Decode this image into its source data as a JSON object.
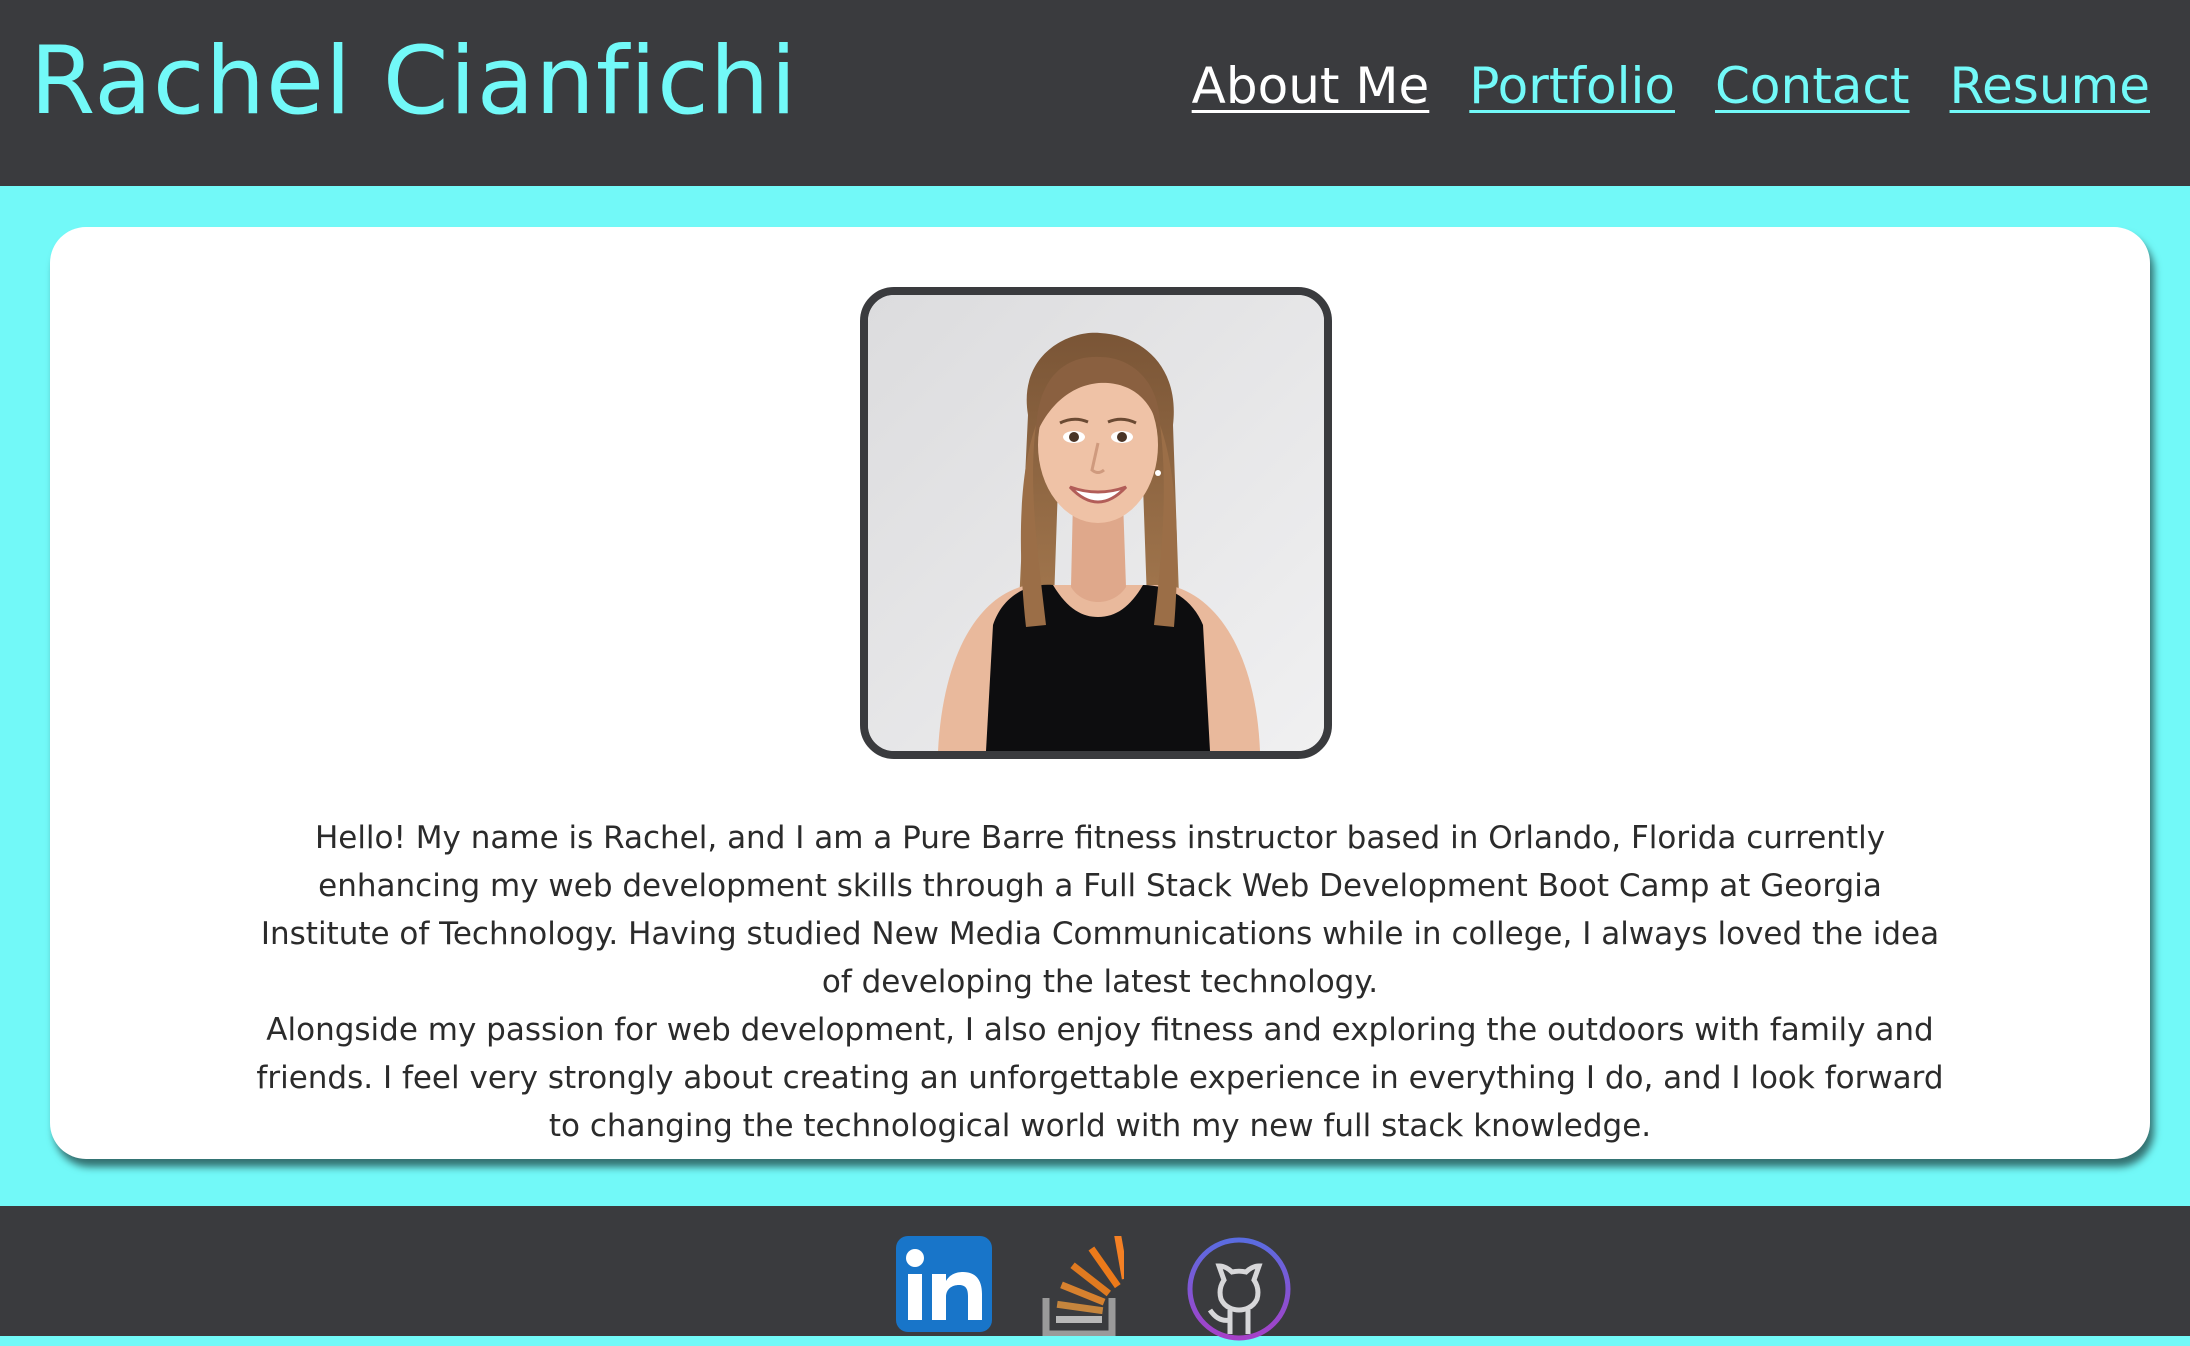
{
  "header": {
    "title": "Rachel Cianfichi",
    "nav": [
      {
        "label": "About Me",
        "active": true
      },
      {
        "label": "Portfolio",
        "active": false
      },
      {
        "label": "Contact",
        "active": false
      },
      {
        "label": "Resume",
        "active": false
      }
    ]
  },
  "about": {
    "photo_alt": "profile-photo",
    "paragraph_1": "Hello! My name is Rachel, and I am a Pure Barre fitness instructor based in Orlando, Florida currently enhancing my web development skills through a Full Stack Web Development Boot Camp at Georgia Institute of Technology. Having studied New Media Communications while in college, I always loved the idea of developing the latest technology.",
    "paragraph_2": "Alongside my passion for web development, I also enjoy fitness and exploring the outdoors with family and friends. I feel very strongly about creating an unforgettable experience in everything I do, and I look forward to changing the technological world with my new full stack knowledge."
  },
  "footer": {
    "icons": [
      "linkedin-icon",
      "stackoverflow-icon",
      "github-icon"
    ]
  },
  "colors": {
    "accent": "#72f9f8",
    "dark": "#3a3b3e",
    "card": "#ffffff",
    "nav_active": "#ffffff"
  }
}
